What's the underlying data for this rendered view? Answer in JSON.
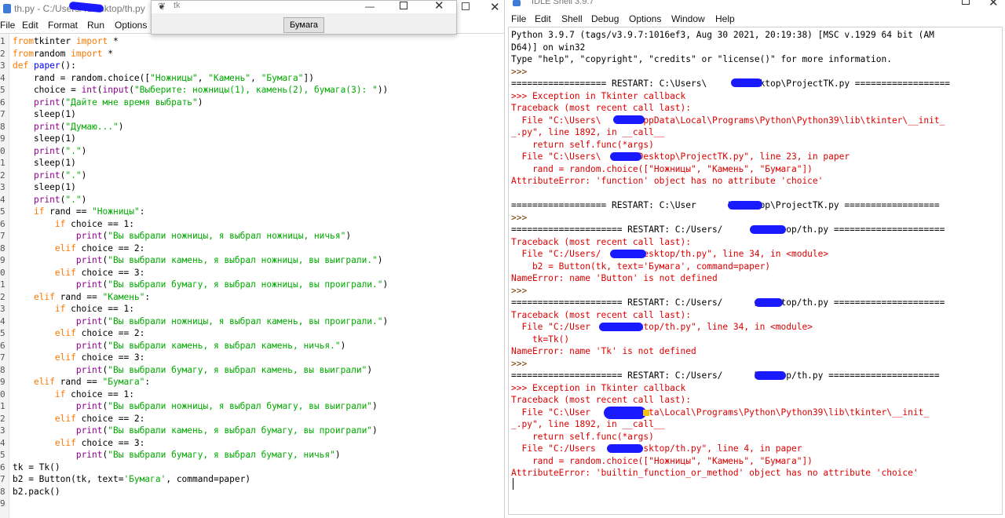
{
  "editor": {
    "title": "th.py - C:/Users/        /Desktop/th.py",
    "menu": [
      "File",
      "Edit",
      "Format",
      "Run",
      "Options"
    ],
    "line_numbers": [
      "1",
      "2",
      "3",
      "4",
      "5",
      "6",
      "7",
      "8",
      "9",
      "0",
      "1",
      "2",
      "3",
      "4",
      "5",
      "6",
      "7",
      "8",
      "9",
      "0",
      "1",
      "2",
      "3",
      "4",
      "5",
      "6",
      "7",
      "8",
      "9",
      "0",
      "1",
      "2",
      "3",
      "4",
      "5",
      "6",
      "7",
      "8",
      "9"
    ],
    "code": [
      [
        [
          "kw",
          "from"
        ],
        [
          "",
          "tkinter "
        ],
        [
          "kw",
          "import"
        ],
        [
          "",
          " *"
        ]
      ],
      [
        [
          "kw",
          "from"
        ],
        [
          "",
          "random "
        ],
        [
          "kw",
          "import"
        ],
        [
          "",
          " *"
        ]
      ],
      [
        [
          "kw",
          "def"
        ],
        [
          "",
          " "
        ],
        [
          "fn",
          "paper"
        ],
        [
          "",
          "():"
        ]
      ],
      [
        [
          "",
          "    rand = random.choice(["
        ],
        [
          "st",
          "\"Ножницы\""
        ],
        [
          "",
          ", "
        ],
        [
          "st",
          "\"Камень\""
        ],
        [
          "",
          ", "
        ],
        [
          "st",
          "\"Бумага\""
        ],
        [
          "",
          "])"
        ]
      ],
      [
        [
          "",
          "    choice = "
        ],
        [
          "bi",
          "int"
        ],
        [
          "",
          "("
        ],
        [
          "bi",
          "input"
        ],
        [
          "",
          "("
        ],
        [
          "st",
          "\"Выберите: ножницы(1), камень(2), бумага(3): \""
        ],
        [
          "",
          "))"
        ]
      ],
      [
        [
          "",
          "    "
        ],
        [
          "bi",
          "print"
        ],
        [
          "",
          "("
        ],
        [
          "st",
          "\"Дайте мне время выбрать\""
        ],
        [
          "",
          ")"
        ]
      ],
      [
        [
          "",
          "    sleep(1)"
        ]
      ],
      [
        [
          "",
          "    "
        ],
        [
          "bi",
          "print"
        ],
        [
          "",
          "("
        ],
        [
          "st",
          "\"Думаю...\""
        ],
        [
          "",
          ")"
        ]
      ],
      [
        [
          "",
          "    sleep(1)"
        ]
      ],
      [
        [
          "",
          "    "
        ],
        [
          "bi",
          "print"
        ],
        [
          "",
          "("
        ],
        [
          "st",
          "\".\""
        ],
        [
          "",
          ")"
        ]
      ],
      [
        [
          "",
          "    sleep(1)"
        ]
      ],
      [
        [
          "",
          "    "
        ],
        [
          "bi",
          "print"
        ],
        [
          "",
          "("
        ],
        [
          "st",
          "\".\""
        ],
        [
          "",
          ")"
        ]
      ],
      [
        [
          "",
          "    sleep(1)"
        ]
      ],
      [
        [
          "",
          "    "
        ],
        [
          "bi",
          "print"
        ],
        [
          "",
          "("
        ],
        [
          "st",
          "\".\""
        ],
        [
          "",
          ")"
        ]
      ],
      [
        [
          "",
          "    "
        ],
        [
          "kw",
          "if"
        ],
        [
          "",
          " rand == "
        ],
        [
          "st",
          "\"Ножницы\""
        ],
        [
          "",
          ":"
        ]
      ],
      [
        [
          "",
          "        "
        ],
        [
          "kw",
          "if"
        ],
        [
          "",
          " choice == 1:"
        ]
      ],
      [
        [
          "",
          "            "
        ],
        [
          "bi",
          "print"
        ],
        [
          "",
          "("
        ],
        [
          "st",
          "\"Вы выбрали ножницы, я выбрал ножницы, ничья\""
        ],
        [
          "",
          ")"
        ]
      ],
      [
        [
          "",
          "        "
        ],
        [
          "kw",
          "elif"
        ],
        [
          "",
          " choice == 2:"
        ]
      ],
      [
        [
          "",
          "            "
        ],
        [
          "bi",
          "print"
        ],
        [
          "",
          "("
        ],
        [
          "st",
          "\"Вы выбрали камень, я выбрал ножницы, вы выиграли.\""
        ],
        [
          "",
          ")"
        ]
      ],
      [
        [
          "",
          "        "
        ],
        [
          "kw",
          "elif"
        ],
        [
          "",
          " choice == 3:"
        ]
      ],
      [
        [
          "",
          "            "
        ],
        [
          "bi",
          "print"
        ],
        [
          "",
          "("
        ],
        [
          "st",
          "\"Вы выбрали бумагу, я выбрал ножницы, вы проиграли.\""
        ],
        [
          "",
          ")"
        ]
      ],
      [
        [
          "",
          "    "
        ],
        [
          "kw",
          "elif"
        ],
        [
          "",
          " rand == "
        ],
        [
          "st",
          "\"Камень\""
        ],
        [
          "",
          ":"
        ]
      ],
      [
        [
          "",
          "        "
        ],
        [
          "kw",
          "if"
        ],
        [
          "",
          " choice == 1:"
        ]
      ],
      [
        [
          "",
          "            "
        ],
        [
          "bi",
          "print"
        ],
        [
          "",
          "("
        ],
        [
          "st",
          "\"Вы выбрали ножницы, я выбрал камень, вы проиграли.\""
        ],
        [
          "",
          ")"
        ]
      ],
      [
        [
          "",
          "        "
        ],
        [
          "kw",
          "elif"
        ],
        [
          "",
          " choice == 2:"
        ]
      ],
      [
        [
          "",
          "            "
        ],
        [
          "bi",
          "print"
        ],
        [
          "",
          "("
        ],
        [
          "st",
          "\"Вы выбрали камень, я выбрал камень, ничья.\""
        ],
        [
          "",
          ")"
        ]
      ],
      [
        [
          "",
          "        "
        ],
        [
          "kw",
          "elif"
        ],
        [
          "",
          " choice == 3:"
        ]
      ],
      [
        [
          "",
          "            "
        ],
        [
          "bi",
          "print"
        ],
        [
          "",
          "("
        ],
        [
          "st",
          "\"Вы выбрали бумагу, я выбрал камень, вы выиграли\""
        ],
        [
          "",
          ")"
        ]
      ],
      [
        [
          "",
          "    "
        ],
        [
          "kw",
          "elif"
        ],
        [
          "",
          " rand == "
        ],
        [
          "st",
          "\"Бумага\""
        ],
        [
          "",
          ":"
        ]
      ],
      [
        [
          "",
          "        "
        ],
        [
          "kw",
          "if"
        ],
        [
          "",
          " choice == 1:"
        ]
      ],
      [
        [
          "",
          "            "
        ],
        [
          "bi",
          "print"
        ],
        [
          "",
          "("
        ],
        [
          "st",
          "\"Вы выбрали ножницы, я выбрал бумагу, вы выиграли\""
        ],
        [
          "",
          ")"
        ]
      ],
      [
        [
          "",
          "        "
        ],
        [
          "kw",
          "elif"
        ],
        [
          "",
          " choice == 2:"
        ]
      ],
      [
        [
          "",
          "            "
        ],
        [
          "bi",
          "print"
        ],
        [
          "",
          "("
        ],
        [
          "st",
          "\"Вы выбрали камень, я выбрал бумагу, вы проиграли\""
        ],
        [
          "",
          ")"
        ]
      ],
      [
        [
          "",
          "        "
        ],
        [
          "kw",
          "elif"
        ],
        [
          "",
          " choice == 3:"
        ]
      ],
      [
        [
          "",
          "            "
        ],
        [
          "bi",
          "print"
        ],
        [
          "",
          "("
        ],
        [
          "st",
          "\"Вы выбрали бумагу, я выбрал бумагу, ничья\""
        ],
        [
          "",
          ")"
        ]
      ],
      [
        [
          "",
          "tk = Tk()"
        ]
      ],
      [
        [
          "",
          "b2 = Button(tk, text="
        ],
        [
          "st",
          "'Бумага'"
        ],
        [
          "",
          ", command=paper)"
        ]
      ],
      [
        [
          "",
          "b2.pack()"
        ]
      ],
      [
        [
          "",
          ""
        ]
      ]
    ]
  },
  "tk_window": {
    "title": "tk",
    "button_label": "Бумага"
  },
  "shell": {
    "title": "IDLE Shell 3.9.7",
    "menu": [
      "File",
      "Edit",
      "Shell",
      "Debug",
      "Options",
      "Window",
      "Help"
    ],
    "lines": [
      [
        "normal",
        "Python 3.9.7 (tags/v3.9.7:1016ef3, Aug 30 2021, 20:19:38) [MSC v.1929 64 bit (AM"
      ],
      [
        "normal",
        "D64)] on win32"
      ],
      [
        "normal",
        "Type \"help\", \"copyright\", \"credits\" or \"license()\" for more information."
      ],
      [
        "prompt",
        ">>>"
      ],
      [
        "normal",
        "================== RESTART: C:\\Users\\      \\Desktop\\ProjectTK.py =================="
      ],
      [
        "err",
        ">>> Exception in Tkinter callback"
      ],
      [
        "err",
        "Traceback (most recent call last):"
      ],
      [
        "err",
        "  File \"C:\\Users\\      \\AppData\\Local\\Programs\\Python\\Python39\\lib\\tkinter\\__init_"
      ],
      [
        "err",
        "_.py\", line 1892, in __call__"
      ],
      [
        "err",
        "    return self.func(*args)"
      ],
      [
        "err",
        "  File \"C:\\Users\\      \\Desktop\\ProjectTK.py\", line 23, in paper"
      ],
      [
        "err",
        "    rand = random.choice([\"Ножницы\", \"Камень\", \"Бумага\"])"
      ],
      [
        "err",
        "AttributeError: 'function' object has no attribute 'choice'"
      ],
      [
        "normal",
        ""
      ],
      [
        "normal",
        "================== RESTART: C:\\User      \\Desktop\\ProjectTK.py =================="
      ],
      [
        "prompt",
        ">>>"
      ],
      [
        "normal",
        "===================== RESTART: C:/Users/      /Desktop/th.py ====================="
      ],
      [
        "err",
        "Traceback (most recent call last):"
      ],
      [
        "err",
        "  File \"C:/Users/      /Desktop/th.py\", line 34, in <module>"
      ],
      [
        "err",
        "    b2 = Button(tk, text='Бумага', command=paper)"
      ],
      [
        "err",
        "NameError: name 'Button' is not defined"
      ],
      [
        "prompt",
        ">>>"
      ],
      [
        "normal",
        "===================== RESTART: C:/Users/      /Desktop/th.py ====================="
      ],
      [
        "err",
        "Traceback (most recent call last):"
      ],
      [
        "err",
        "  File \"C:/User      Desktop/th.py\", line 34, in <module>"
      ],
      [
        "err",
        "    tk=Tk()"
      ],
      [
        "err",
        "NameError: name 'Tk' is not defined"
      ],
      [
        "prompt",
        ">>>"
      ],
      [
        "normal",
        "===================== RESTART: C:/Users/      Desktop/th.py ====================="
      ],
      [
        "err",
        ">>> Exception in Tkinter callback"
      ],
      [
        "err",
        "Traceback (most recent call last):"
      ],
      [
        "err",
        "  File \"C:\\User      AppData\\Local\\Programs\\Python\\Python39\\lib\\tkinter\\__init_"
      ],
      [
        "err",
        "_.py\", line 1892, in __call__"
      ],
      [
        "err",
        "    return self.func(*args)"
      ],
      [
        "err",
        "  File \"C:/Users      /Desktop/th.py\", line 4, in paper"
      ],
      [
        "err",
        "    rand = random.choice([\"Ножницы\", \"Камень\", \"Бумага\"])"
      ],
      [
        "err",
        "AttributeError: 'builtin_function_or_method' object has no attribute 'choice'"
      ]
    ]
  },
  "colors": {
    "keyword": "#ff7700",
    "builtin": "#900090",
    "string": "#00aa00",
    "defname": "#0000ff",
    "error": "#dd0000",
    "redaction": "#1a1aff"
  }
}
